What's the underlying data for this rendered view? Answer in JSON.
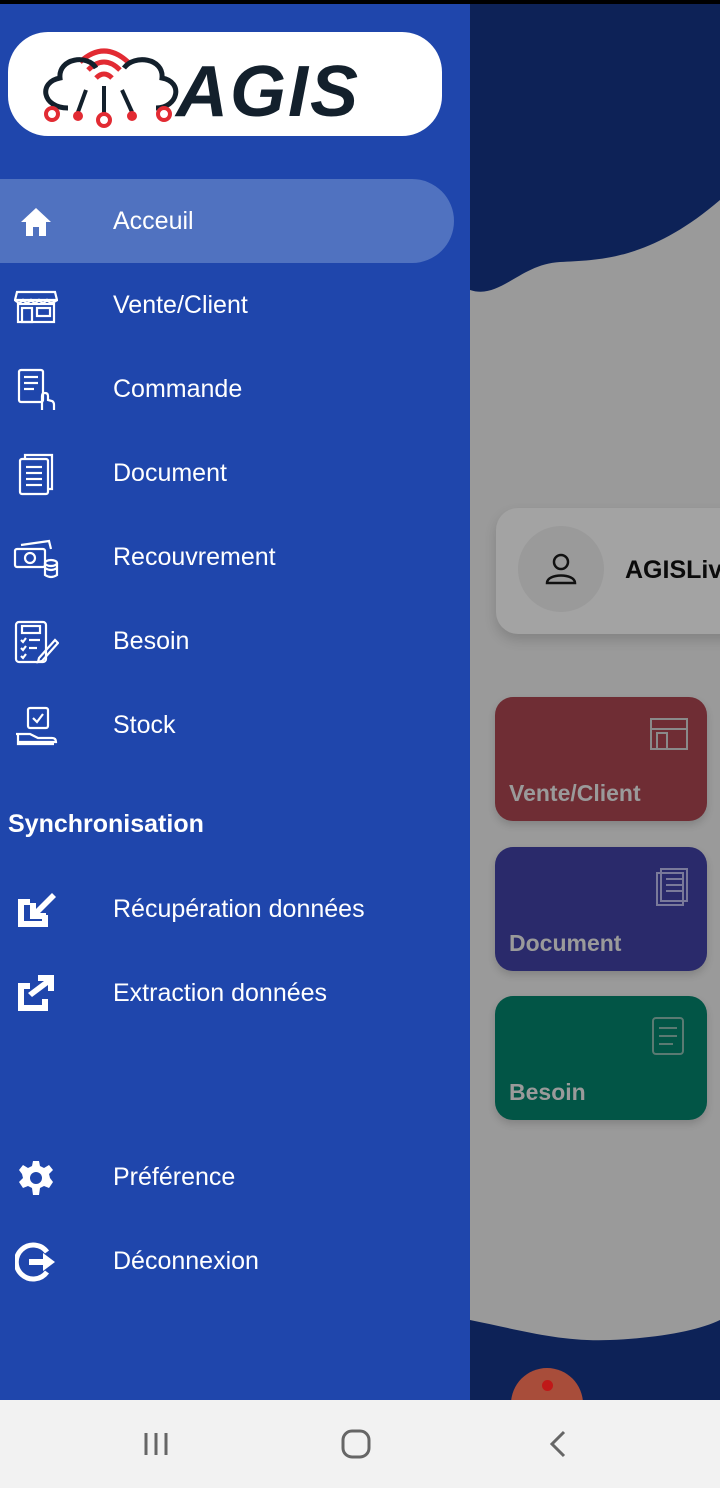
{
  "brand": {
    "logo_text": "AGIS",
    "colors": {
      "logo_red": "#e22b33",
      "logo_dark": "#13202c",
      "drawer": "#1f46ac",
      "active": "#5072c0"
    }
  },
  "nav": {
    "items": [
      {
        "label": "Acceuil",
        "icon": "home-icon",
        "active": true
      },
      {
        "label": "Vente/Client",
        "icon": "store-icon"
      },
      {
        "label": "Commande",
        "icon": "order-list-icon"
      },
      {
        "label": "Document",
        "icon": "document-icon"
      },
      {
        "label": "Recouvrement",
        "icon": "money-coins-icon"
      },
      {
        "label": "Besoin",
        "icon": "checklist-icon"
      },
      {
        "label": "Stock",
        "icon": "box-hand-icon"
      }
    ],
    "sync_title": "Synchronisation",
    "sync_items": [
      {
        "label": "Récupération données",
        "icon": "import-icon"
      },
      {
        "label": "Extraction données",
        "icon": "export-icon"
      }
    ],
    "bottom_items": [
      {
        "label": "Préférence",
        "icon": "gear-icon"
      },
      {
        "label": "Déconnexion",
        "icon": "logout-icon"
      }
    ]
  },
  "background": {
    "profile_name": "AGISLiv",
    "tiles": [
      "Vente/Client",
      "Document",
      "Besoin"
    ]
  },
  "system_nav": {
    "recents": "recents-icon",
    "home": "home-circle-icon",
    "back": "back-icon"
  }
}
